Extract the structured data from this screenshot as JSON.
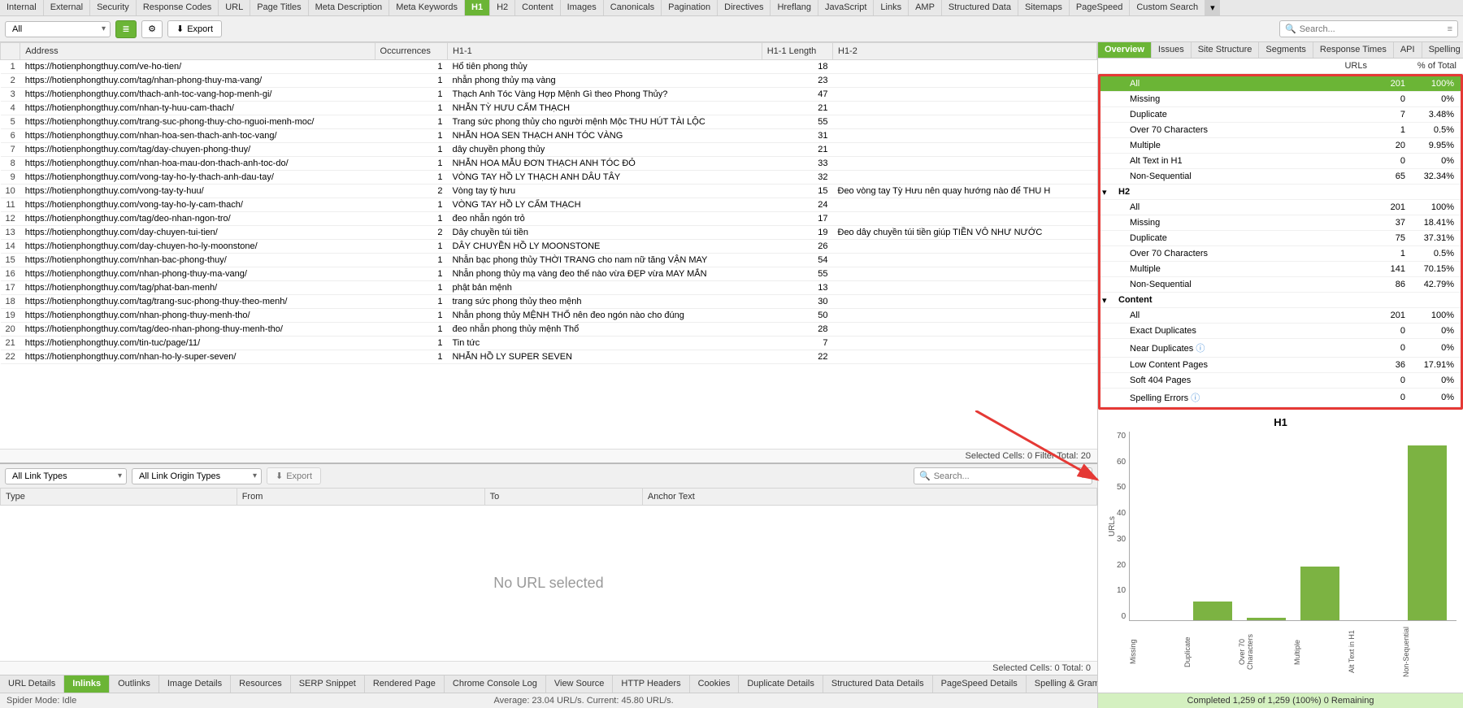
{
  "tabs_top": [
    "Internal",
    "External",
    "Security",
    "Response Codes",
    "URL",
    "Page Titles",
    "Meta Description",
    "Meta Keywords",
    "H1",
    "H2",
    "Content",
    "Images",
    "Canonicals",
    "Pagination",
    "Directives",
    "Hreflang",
    "JavaScript",
    "Links",
    "AMP",
    "Structured Data",
    "Sitemaps",
    "PageSpeed",
    "Custom Search"
  ],
  "tabs_top_active": "H1",
  "toolbar": {
    "filter": "All",
    "export": "Export"
  },
  "search": {
    "placeholder": "Search..."
  },
  "columns": [
    "",
    "Address",
    "Occurrences",
    "H1-1",
    "H1-1 Length",
    "H1-2"
  ],
  "rows": [
    {
      "n": 1,
      "addr": "https://hotienphongthuy.com/ve-ho-tien/",
      "occ": 1,
      "h1": "Hổ tiên phong thủy",
      "len": 18,
      "h12": ""
    },
    {
      "n": 2,
      "addr": "https://hotienphongthuy.com/tag/nhan-phong-thuy-ma-vang/",
      "occ": 1,
      "h1": "nhẫn phong thủy mạ vàng",
      "len": 23,
      "h12": ""
    },
    {
      "n": 3,
      "addr": "https://hotienphongthuy.com/thach-anh-toc-vang-hop-menh-gi/",
      "occ": 1,
      "h1": "Thạch Anh Tóc Vàng Hợp Mệnh Gì theo Phong Thủy?",
      "len": 47,
      "h12": ""
    },
    {
      "n": 4,
      "addr": "https://hotienphongthuy.com/nhan-ty-huu-cam-thach/",
      "occ": 1,
      "h1": "NHẪN TỲ HƯU CẨM THẠCH",
      "len": 21,
      "h12": ""
    },
    {
      "n": 5,
      "addr": "https://hotienphongthuy.com/trang-suc-phong-thuy-cho-nguoi-menh-moc/",
      "occ": 1,
      "h1": "Trang sức phong thủy cho người mệnh Mộc THU HÚT TÀI LỘC",
      "len": 55,
      "h12": ""
    },
    {
      "n": 6,
      "addr": "https://hotienphongthuy.com/nhan-hoa-sen-thach-anh-toc-vang/",
      "occ": 1,
      "h1": "NHẪN HOA SEN THẠCH ANH TÓC VÀNG",
      "len": 31,
      "h12": ""
    },
    {
      "n": 7,
      "addr": "https://hotienphongthuy.com/tag/day-chuyen-phong-thuy/",
      "occ": 1,
      "h1": "dây chuyền phong thủy",
      "len": 21,
      "h12": ""
    },
    {
      "n": 8,
      "addr": "https://hotienphongthuy.com/nhan-hoa-mau-don-thach-anh-toc-do/",
      "occ": 1,
      "h1": "NHẪN HOA MẪU ĐƠN THẠCH ANH TÓC ĐỎ",
      "len": 33,
      "h12": ""
    },
    {
      "n": 9,
      "addr": "https://hotienphongthuy.com/vong-tay-ho-ly-thach-anh-dau-tay/",
      "occ": 1,
      "h1": "VÒNG TAY HỒ LY THẠCH ANH DÂU TÂY",
      "len": 32,
      "h12": ""
    },
    {
      "n": 10,
      "addr": "https://hotienphongthuy.com/vong-tay-ty-huu/",
      "occ": 2,
      "h1": "Vòng tay tỳ hưu",
      "len": 15,
      "h12": "Đeo vòng tay Tỳ Hưu nên quay hướng nào để THU H"
    },
    {
      "n": 11,
      "addr": "https://hotienphongthuy.com/vong-tay-ho-ly-cam-thach/",
      "occ": 1,
      "h1": "VÒNG TAY HỒ LY CẨM THẠCH",
      "len": 24,
      "h12": ""
    },
    {
      "n": 12,
      "addr": "https://hotienphongthuy.com/tag/deo-nhan-ngon-tro/",
      "occ": 1,
      "h1": "đeo nhẫn ngón trỏ",
      "len": 17,
      "h12": ""
    },
    {
      "n": 13,
      "addr": "https://hotienphongthuy.com/day-chuyen-tui-tien/",
      "occ": 2,
      "h1": "Dây chuyền túi tiền",
      "len": 19,
      "h12": "Đeo dây chuyền túi tiền giúp TIỀN VÔ NHƯ NƯỚC"
    },
    {
      "n": 14,
      "addr": "https://hotienphongthuy.com/day-chuyen-ho-ly-moonstone/",
      "occ": 1,
      "h1": "DÂY CHUYỀN HỒ LY MOONSTONE",
      "len": 26,
      "h12": ""
    },
    {
      "n": 15,
      "addr": "https://hotienphongthuy.com/nhan-bac-phong-thuy/",
      "occ": 1,
      "h1": "Nhẫn bạc phong thủy THỜI TRANG cho nam nữ tăng VẬN MAY",
      "len": 54,
      "h12": ""
    },
    {
      "n": 16,
      "addr": "https://hotienphongthuy.com/nhan-phong-thuy-ma-vang/",
      "occ": 1,
      "h1": "Nhẫn phong thủy mạ vàng đeo thế nào vừa ĐẸP vừa MAY MẮN",
      "len": 55,
      "h12": ""
    },
    {
      "n": 17,
      "addr": "https://hotienphongthuy.com/tag/phat-ban-menh/",
      "occ": 1,
      "h1": "phật bản mệnh",
      "len": 13,
      "h12": ""
    },
    {
      "n": 18,
      "addr": "https://hotienphongthuy.com/tag/trang-suc-phong-thuy-theo-menh/",
      "occ": 1,
      "h1": "trang sức phong thủy theo mệnh",
      "len": 30,
      "h12": ""
    },
    {
      "n": 19,
      "addr": "https://hotienphongthuy.com/nhan-phong-thuy-menh-tho/",
      "occ": 1,
      "h1": "Nhẫn phong thủy MỆNH THỔ nên đeo ngón nào cho đúng",
      "len": 50,
      "h12": ""
    },
    {
      "n": 20,
      "addr": "https://hotienphongthuy.com/tag/deo-nhan-phong-thuy-menh-tho/",
      "occ": 1,
      "h1": "đeo nhẫn phong thủy mệnh Thổ",
      "len": 28,
      "h12": ""
    },
    {
      "n": 21,
      "addr": "https://hotienphongthuy.com/tin-tuc/page/11/",
      "occ": 1,
      "h1": "Tin tức",
      "len": 7,
      "h12": ""
    },
    {
      "n": 22,
      "addr": "https://hotienphongthuy.com/nhan-ho-ly-super-seven/",
      "occ": 1,
      "h1": "NHẪN HỒ LY SUPER SEVEN",
      "len": 22,
      "h12": ""
    }
  ],
  "table_status": "Selected Cells: 0  Filter Total: 20",
  "lower": {
    "link_types": "All Link Types",
    "origin_types": "All Link Origin Types",
    "export": "Export",
    "columns": [
      "Type",
      "From",
      "To",
      "Anchor Text"
    ],
    "empty": "No URL selected",
    "status": "Selected Cells: 0  Total: 0"
  },
  "tabs_bottom": [
    "URL Details",
    "Inlinks",
    "Outlinks",
    "Image Details",
    "Resources",
    "SERP Snippet",
    "Rendered Page",
    "Chrome Console Log",
    "View Source",
    "HTTP Headers",
    "Cookies",
    "Duplicate Details",
    "Structured Data Details",
    "PageSpeed Details",
    "Spelling & Grammar Details"
  ],
  "tabs_bottom_active": "Inlinks",
  "statusbar": {
    "left": "Spider Mode: Idle",
    "center": "Average: 23.04 URL/s. Current: 45.80 URL/s."
  },
  "progress": "Completed 1,259 of 1,259 (100%) 0 Remaining",
  "right_tabs": [
    "Overview",
    "Issues",
    "Site Structure",
    "Segments",
    "Response Times",
    "API",
    "Spelling & Gram"
  ],
  "right_tabs_active": "Overview",
  "right_header": {
    "urls": "URLs",
    "pct": "% of Total"
  },
  "overview": [
    {
      "label": "All",
      "urls": 201,
      "pct": "100%",
      "sel": true
    },
    {
      "label": "Missing",
      "urls": 0,
      "pct": "0%"
    },
    {
      "label": "Duplicate",
      "urls": 7,
      "pct": "3.48%"
    },
    {
      "label": "Over 70 Characters",
      "urls": 1,
      "pct": "0.5%"
    },
    {
      "label": "Multiple",
      "urls": 20,
      "pct": "9.95%"
    },
    {
      "label": "Alt Text in H1",
      "urls": 0,
      "pct": "0%"
    },
    {
      "label": "Non-Sequential",
      "urls": 65,
      "pct": "32.34%"
    },
    {
      "section": true,
      "label": "H2"
    },
    {
      "label": "All",
      "urls": 201,
      "pct": "100%"
    },
    {
      "label": "Missing",
      "urls": 37,
      "pct": "18.41%"
    },
    {
      "label": "Duplicate",
      "urls": 75,
      "pct": "37.31%"
    },
    {
      "label": "Over 70 Characters",
      "urls": 1,
      "pct": "0.5%"
    },
    {
      "label": "Multiple",
      "urls": 141,
      "pct": "70.15%"
    },
    {
      "label": "Non-Sequential",
      "urls": 86,
      "pct": "42.79%"
    },
    {
      "section": true,
      "label": "Content"
    },
    {
      "label": "All",
      "urls": 201,
      "pct": "100%"
    },
    {
      "label": "Exact Duplicates",
      "urls": 0,
      "pct": "0%"
    },
    {
      "label": "Near Duplicates",
      "urls": 0,
      "pct": "0%",
      "info": true
    },
    {
      "label": "Low Content Pages",
      "urls": 36,
      "pct": "17.91%"
    },
    {
      "label": "Soft 404 Pages",
      "urls": 0,
      "pct": "0%"
    },
    {
      "label": "Spelling Errors",
      "urls": 0,
      "pct": "0%",
      "info": true
    }
  ],
  "chart_data": {
    "type": "bar",
    "title": "H1",
    "ylabel": "URLs",
    "ylim": [
      0,
      70
    ],
    "yticks": [
      0,
      10,
      20,
      30,
      40,
      50,
      60,
      70
    ],
    "categories": [
      "Missing",
      "Duplicate",
      "Over 70 Characters",
      "Multiple",
      "Alt Text in H1",
      "Non-Sequential"
    ],
    "values": [
      0,
      7,
      1,
      20,
      0,
      65
    ]
  }
}
